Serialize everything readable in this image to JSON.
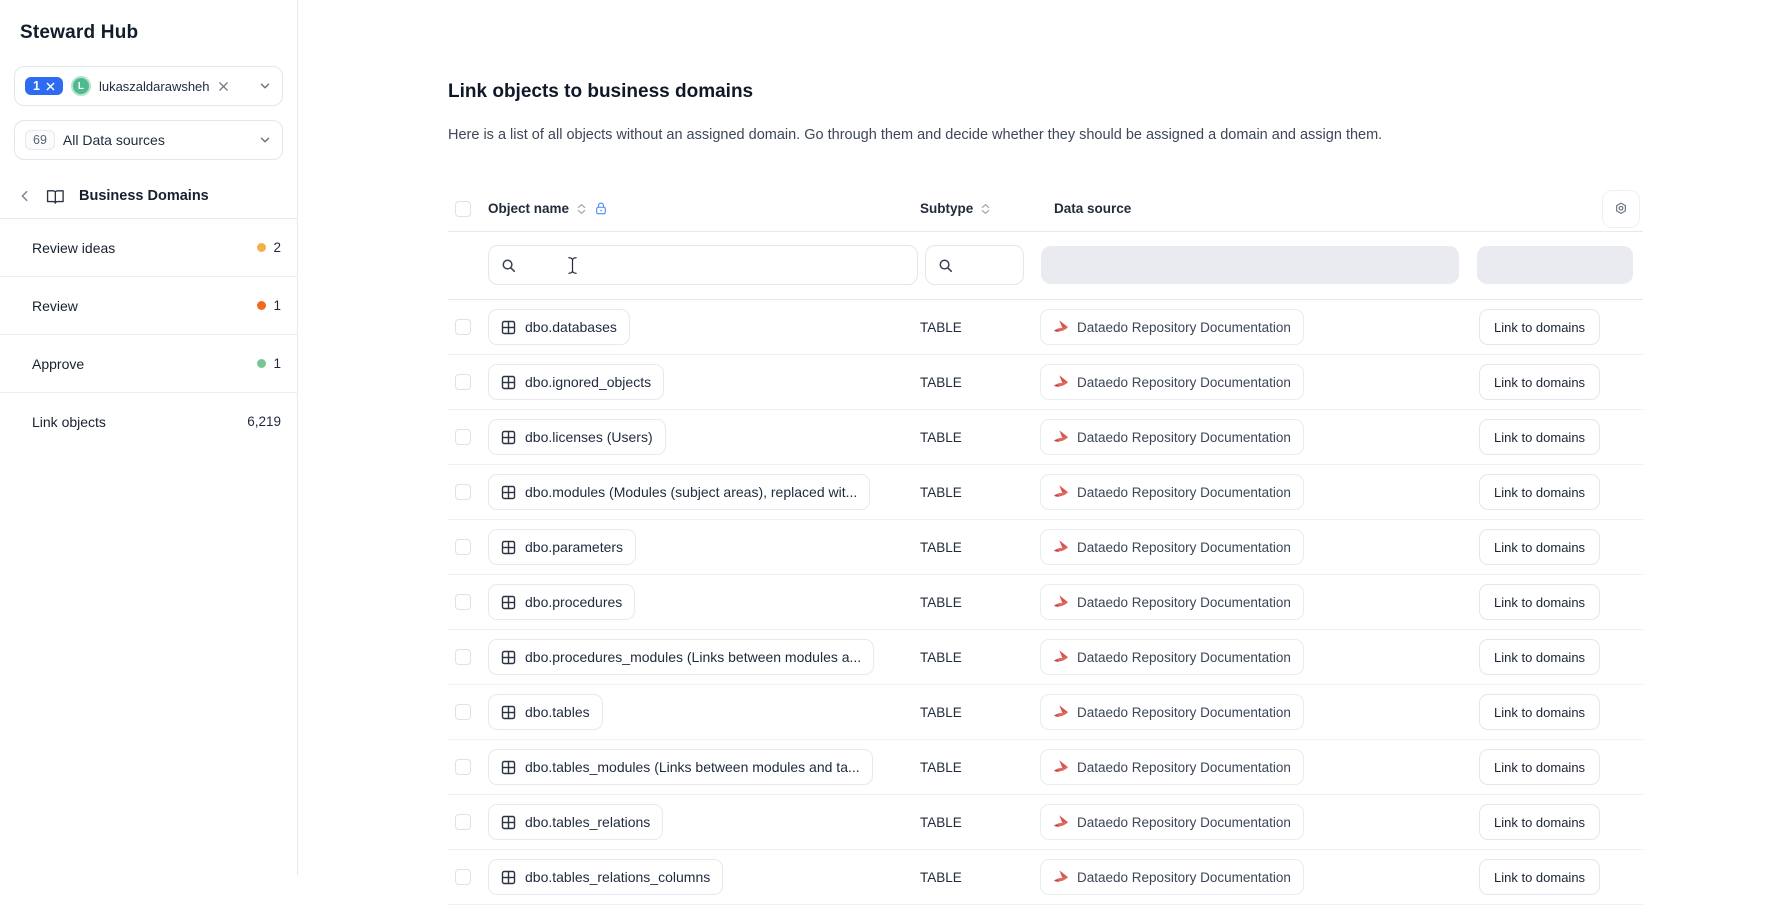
{
  "app": {
    "title": "Steward Hub"
  },
  "sidebar": {
    "user_filter": {
      "selected_count": "1",
      "user_initial": "L",
      "user_name": "lukaszaldarawsheh"
    },
    "source_filter": {
      "count": "69",
      "label": "All Data sources"
    },
    "section_header": {
      "label": "Business Domains"
    },
    "items": [
      {
        "label": "Review ideas",
        "count": "2",
        "dot_color": "#f2b04a"
      },
      {
        "label": "Review",
        "count": "1",
        "dot_color": "#f4671f"
      },
      {
        "label": "Approve",
        "count": "1",
        "dot_color": "#77c693"
      },
      {
        "label": "Link objects",
        "count": "6,219",
        "dot_color": ""
      }
    ]
  },
  "main": {
    "title": "Link objects to business domains",
    "description": "Here is a list of all objects without an assigned domain. Go through them and decide whether they should be assigned a domain and assign them.",
    "table": {
      "headers": {
        "object_name": "Object name",
        "subtype": "Subtype",
        "data_source": "Data source"
      },
      "action_label": "Link to domains",
      "rows": [
        {
          "name": "dbo.databases",
          "subtype": "TABLE",
          "source": "Dataedo Repository Documentation"
        },
        {
          "name": "dbo.ignored_objects",
          "subtype": "TABLE",
          "source": "Dataedo Repository Documentation"
        },
        {
          "name": "dbo.licenses (Users)",
          "subtype": "TABLE",
          "source": "Dataedo Repository Documentation"
        },
        {
          "name": "dbo.modules (Modules (subject areas), replaced wit...",
          "subtype": "TABLE",
          "source": "Dataedo Repository Documentation"
        },
        {
          "name": "dbo.parameters",
          "subtype": "TABLE",
          "source": "Dataedo Repository Documentation"
        },
        {
          "name": "dbo.procedures",
          "subtype": "TABLE",
          "source": "Dataedo Repository Documentation"
        },
        {
          "name": "dbo.procedures_modules (Links between modules a...",
          "subtype": "TABLE",
          "source": "Dataedo Repository Documentation"
        },
        {
          "name": "dbo.tables",
          "subtype": "TABLE",
          "source": "Dataedo Repository Documentation"
        },
        {
          "name": "dbo.tables_modules (Links between modules and ta...",
          "subtype": "TABLE",
          "source": "Dataedo Repository Documentation"
        },
        {
          "name": "dbo.tables_relations",
          "subtype": "TABLE",
          "source": "Dataedo Repository Documentation"
        },
        {
          "name": "dbo.tables_relations_columns",
          "subtype": "TABLE",
          "source": "Dataedo Repository Documentation"
        }
      ]
    }
  },
  "icons": {
    "search": "search-icon (magnifier)",
    "sort": "sort-icon (up/down chevrons)",
    "lock": "lock-icon",
    "gear": "gear-icon (settings)",
    "book": "book-icon (open book)",
    "chevron_left": "chevron-left-icon",
    "chevron_down": "chevron-down-icon",
    "close": "close-icon (x)",
    "table_grid": "table-grid-icon",
    "dataedo_logo": "dataedo-logo-icon (red origami bird)",
    "text_cursor": "i-beam mouse cursor"
  },
  "colors": {
    "accent_blue": "#2d6bf0",
    "avatar_green": "#4fba8c",
    "dot_amber": "#f2b04a",
    "dot_orange": "#f4671f",
    "dot_green": "#77c693",
    "dataedo_red": "#d95550",
    "lock_blue": "#5b93f5",
    "border": "#e7e9ee",
    "disabled_fill": "#e9ebf0"
  }
}
